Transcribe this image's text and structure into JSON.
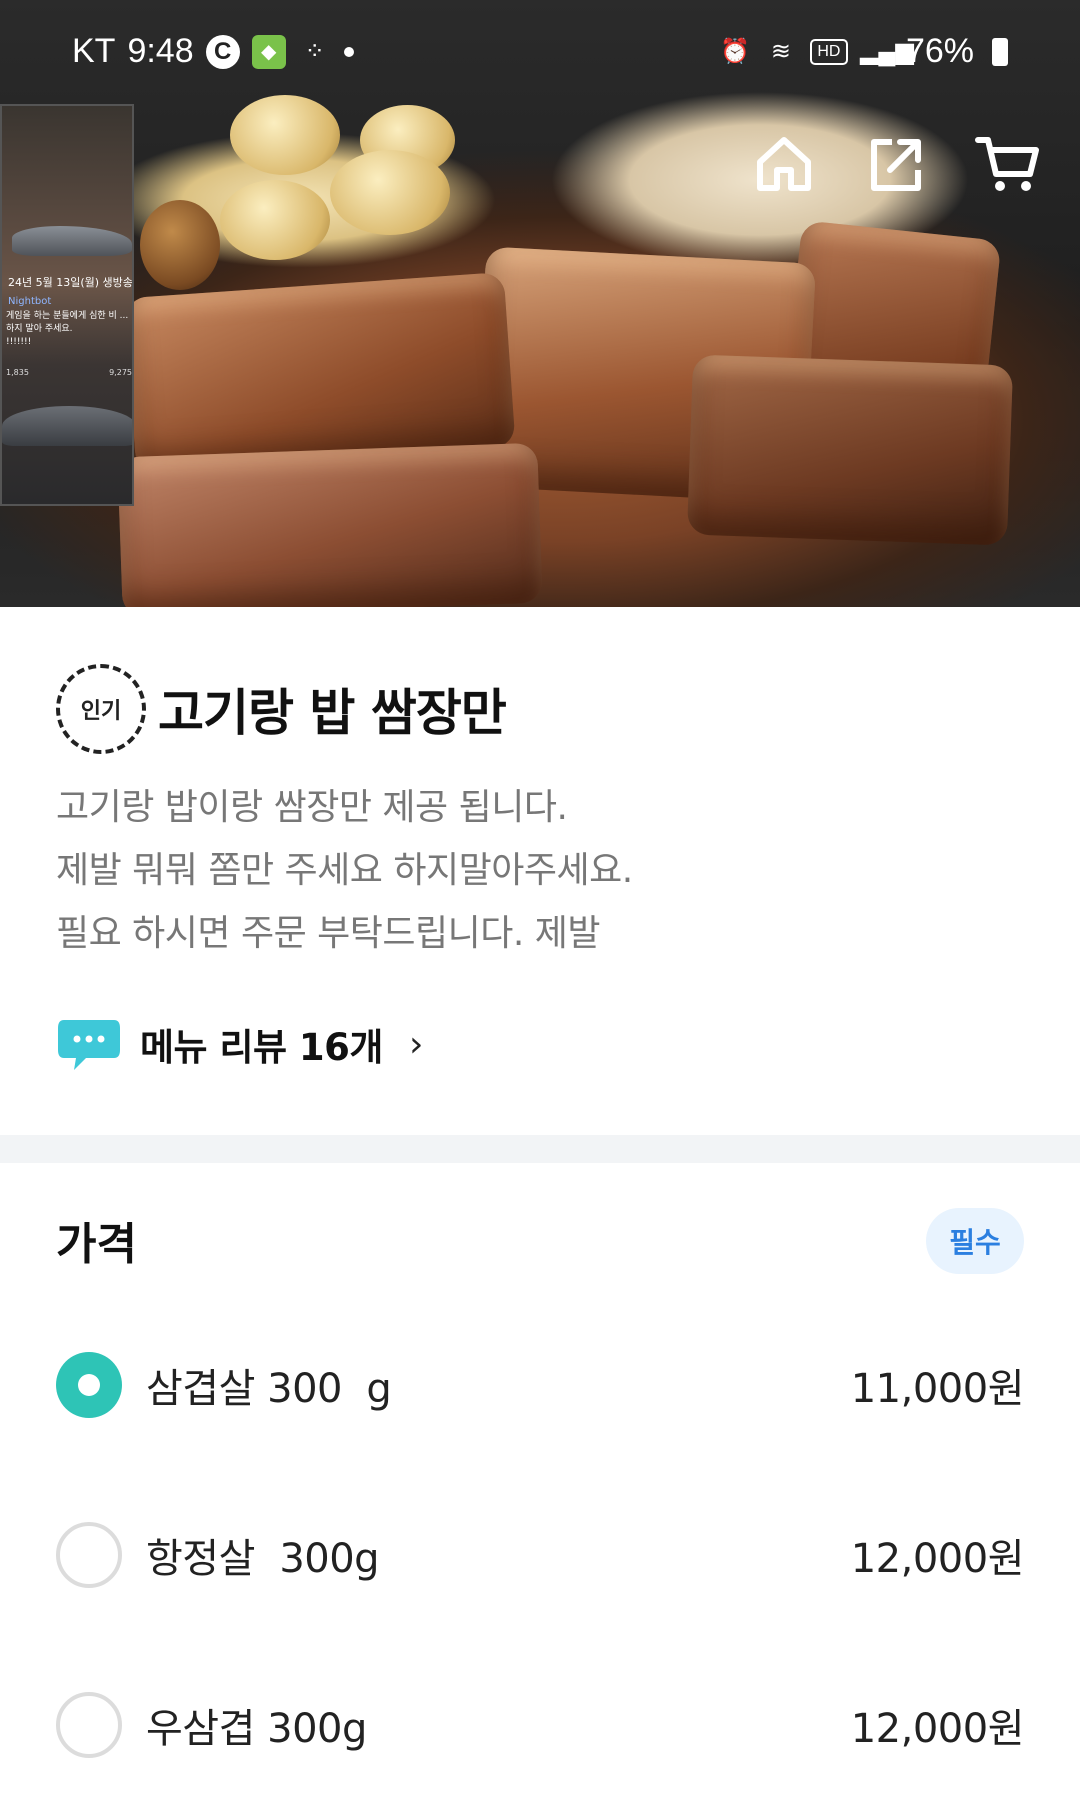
{
  "status_bar": {
    "carrier": "KT",
    "time": "9:48",
    "battery": "76%"
  },
  "pip_overlay": {
    "date_text": "24년 5월 13일(월) 생방송",
    "bot_name": "Nightbot",
    "chat_text": "게임을 하는 분들에게 심한 비 ... 하지 말아 주세요.",
    "chat_text2": "!!!!!!!",
    "stat1": "1,835",
    "stat2": "9,275"
  },
  "nav": {
    "home_icon": "home-icon",
    "share_icon": "share-icon",
    "cart_icon": "cart-icon"
  },
  "menu": {
    "badge": "인기",
    "title": "고기랑 밥 쌈장만",
    "description": [
      "고기랑 밥이랑 쌈장만 제공 됩니다.",
      "제발 뭐뭐 쫌만 주세요 하지말아주세요.",
      "필요 하시면 주문 부탁드립니다. 제발"
    ],
    "review_label": "메뉴 리뷰 16개"
  },
  "price_section": {
    "title": "가격",
    "required_label": "필수",
    "options": [
      {
        "label": "삼겹살 300  g",
        "price": "11,000원",
        "selected": true
      },
      {
        "label": "항정살  300g",
        "price": "12,000원",
        "selected": false
      },
      {
        "label": "우삼겹 300g",
        "price": "12,000원",
        "selected": false
      }
    ]
  },
  "colors": {
    "accent": "#2ec4b6",
    "required_text": "#2b7fe0",
    "required_bg": "#e8f3fe",
    "review_bubble": "#3ec8d8",
    "divider": "#f2f4f6"
  }
}
